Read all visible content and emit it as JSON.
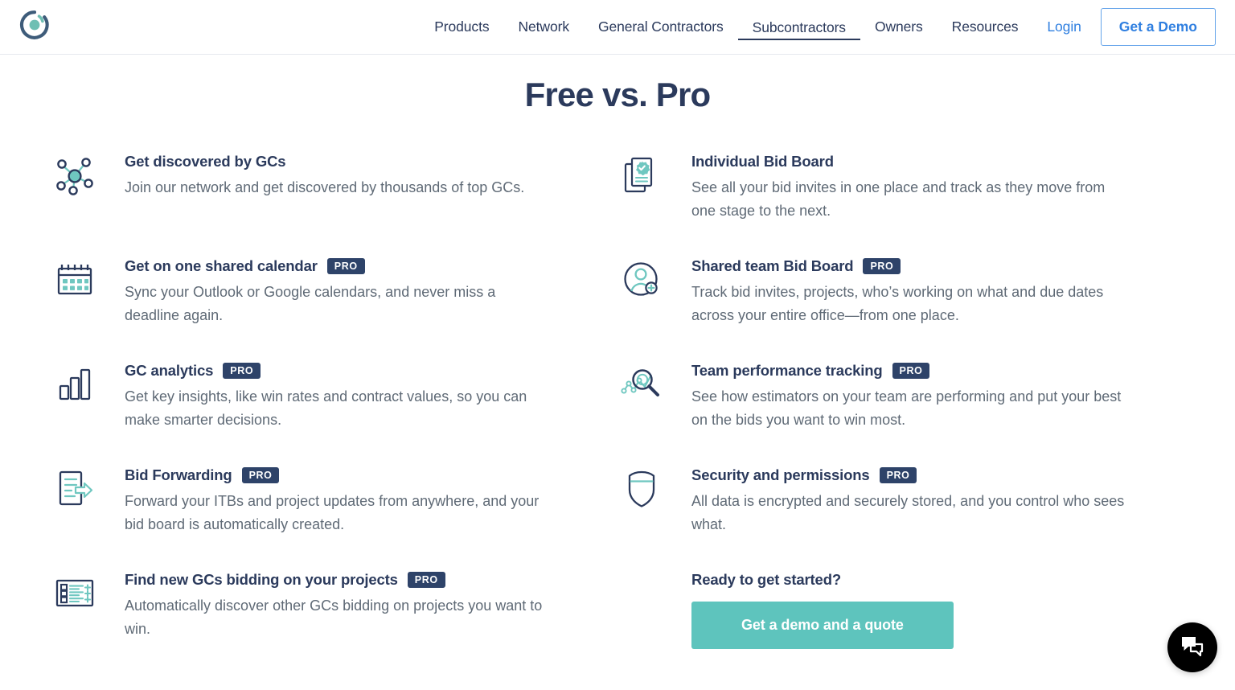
{
  "header": {
    "logo_icon": "circular-c-logo",
    "nav": [
      {
        "label": "Products",
        "active": false,
        "style": "default"
      },
      {
        "label": "Network",
        "active": false,
        "style": "default"
      },
      {
        "label": "General Contractors",
        "active": false,
        "style": "default"
      },
      {
        "label": "Subcontractors",
        "active": true,
        "style": "default"
      },
      {
        "label": "Owners",
        "active": false,
        "style": "default"
      },
      {
        "label": "Resources",
        "active": false,
        "style": "default"
      },
      {
        "label": "Login",
        "active": false,
        "style": "link"
      }
    ],
    "demo_button": "Get a Demo"
  },
  "page": {
    "title": "Free vs. Pro"
  },
  "badges": {
    "pro": "PRO"
  },
  "colors": {
    "navy": "#2b3a5c",
    "badge_navy": "#2e4369",
    "teal": "#5ec4bd",
    "link_blue": "#2f7fe0",
    "body_gray": "#5f6a76",
    "chat_black": "#000000"
  },
  "features_left": [
    {
      "icon": "network-nodes-icon",
      "title": "Get discovered by GCs",
      "pro": false,
      "desc": "Join our network and get discovered by thousands of top GCs."
    },
    {
      "icon": "calendar-icon",
      "title": "Get on one shared calendar",
      "pro": true,
      "desc": "Sync your Outlook or Google calendars, and never miss a deadline again."
    },
    {
      "icon": "bar-chart-icon",
      "title": "GC analytics",
      "pro": true,
      "desc": "Get key insights, like win rates and contract values, so you can make smarter decisions."
    },
    {
      "icon": "document-forward-arrow-icon",
      "title": "Bid Forwarding",
      "pro": true,
      "desc": "Forward your ITBs and project updates from anywhere, and your bid board is automatically created."
    },
    {
      "icon": "checklist-plus-icon",
      "title": "Find new GCs bidding on your projects",
      "pro": true,
      "desc": "Automatically discover other GCs bidding on projects you want to win."
    }
  ],
  "features_right": [
    {
      "icon": "verified-documents-icon",
      "title": "Individual Bid Board",
      "pro": false,
      "desc": "See all your bid invites in one place and track as they move from one stage to the next."
    },
    {
      "icon": "add-user-icon",
      "title": "Shared team Bid Board",
      "pro": true,
      "desc": "Track bid invites, projects, who’s working on what and due dates across your entire office—from one place."
    },
    {
      "icon": "magnifier-chart-icon",
      "title": "Team performance tracking",
      "pro": true,
      "desc": "See how estimators on your team are performing and put your best on the bids you want to win most."
    },
    {
      "icon": "shield-icon",
      "title": "Security and permissions",
      "pro": true,
      "desc": "All data is encrypted and securely stored, and you control who sees what."
    }
  ],
  "cta": {
    "title": "Ready to get started?",
    "button": "Get a demo and a quote"
  },
  "chat": {
    "icon": "chat-bubbles-icon"
  }
}
